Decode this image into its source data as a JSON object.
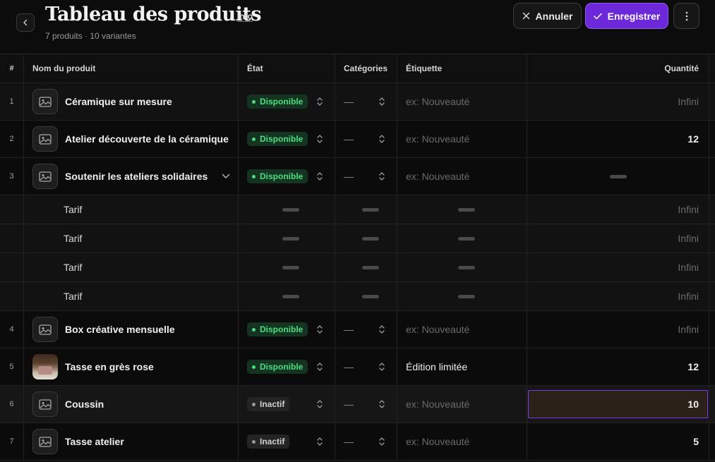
{
  "header": {
    "title": "Tableau des produits",
    "info_label": "Info",
    "subtitle": "7 produits · 10 variantes",
    "cancel_label": "Annuler",
    "save_label": "Enregistrer"
  },
  "colors": {
    "accent": "#6d28d9",
    "available": "#4ade80",
    "edit_cell": "#2b2118"
  },
  "table": {
    "columns": {
      "num": "#",
      "name": "Nom du produit",
      "state": "État",
      "categories": "Catégories",
      "tag": "Étiquette",
      "quantity": "Quantité"
    },
    "rows": [
      {
        "num": "1",
        "name": "Céramique sur mesure",
        "state": "Disponible",
        "category": "—",
        "tag": "ex: Nouveauté",
        "quantity": "Infini"
      },
      {
        "num": "2",
        "name": "Atelier découverte de la céramique",
        "state": "Disponible",
        "category": "—",
        "tag": "ex: Nouveauté",
        "quantity": "12"
      },
      {
        "num": "3",
        "name": "Soutenir les ateliers solidaires",
        "state": "Disponible",
        "category": "—",
        "tag": "ex: Nouveauté",
        "quantity": ""
      },
      {
        "num": "4",
        "name": "Box créative mensuelle",
        "state": "Disponible",
        "category": "—",
        "tag": "ex: Nouveauté",
        "quantity": "Infini"
      },
      {
        "num": "5",
        "name": "Tasse en grès rose",
        "state": "Disponible",
        "category": "—",
        "tag": "Édition limitée",
        "quantity": "12"
      },
      {
        "num": "6",
        "name": "Coussin",
        "state": "Inactif",
        "category": "—",
        "tag": "ex: Nouveauté",
        "quantity": "10"
      },
      {
        "num": "7",
        "name": "Tasse atelier",
        "state": "Inactif",
        "category": "—",
        "tag": "ex: Nouveauté",
        "quantity": "5"
      }
    ],
    "variants": [
      {
        "name": "Tarif",
        "quantity": "Infini"
      },
      {
        "name": "Tarif",
        "quantity": "Infini"
      },
      {
        "name": "Tarif",
        "quantity": "Infini"
      },
      {
        "name": "Tarif",
        "quantity": "Infini"
      }
    ]
  }
}
